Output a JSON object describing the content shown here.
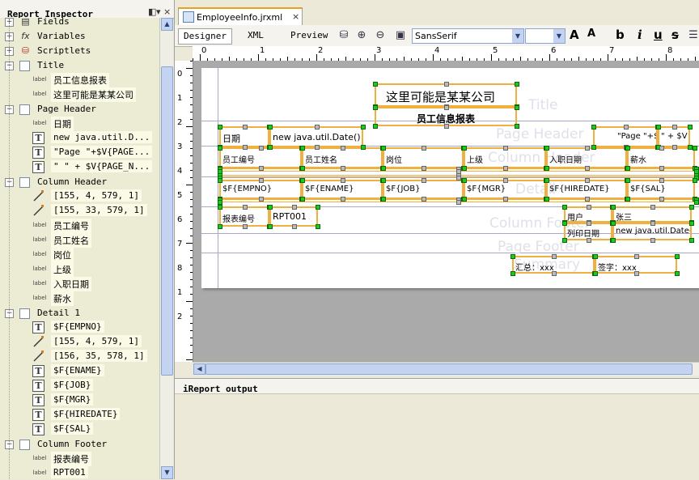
{
  "inspector": {
    "title": "Report Inspector",
    "buttons": [
      "◧",
      "▾",
      "×"
    ],
    "rows": [
      {
        "label": "Fields",
        "type": "category"
      },
      {
        "label": "Variables",
        "type": "category"
      },
      {
        "label": "Scriptlets",
        "type": "category"
      },
      {
        "label": "Title",
        "type": "band"
      },
      {
        "label": "员工信息报表",
        "type": "label"
      },
      {
        "label": "这里可能是某某公司",
        "type": "label"
      },
      {
        "label": "Page Header",
        "type": "band"
      },
      {
        "label": "日期",
        "type": "label"
      },
      {
        "label": "new java.util.D...",
        "type": "textfield"
      },
      {
        "label": "\"Page \"+$V{PAGE...",
        "type": "textfield"
      },
      {
        "label": "\" \" + $V{PAGE_N...",
        "type": "textfield"
      },
      {
        "label": "Column Header",
        "type": "band"
      },
      {
        "label": "[155, 4, 579, 1]",
        "type": "line"
      },
      {
        "label": "[155, 33, 579, 1]",
        "type": "line"
      },
      {
        "label": "员工编号",
        "type": "label"
      },
      {
        "label": "员工姓名",
        "type": "label"
      },
      {
        "label": "岗位",
        "type": "label"
      },
      {
        "label": "上级",
        "type": "label"
      },
      {
        "label": "入职日期",
        "type": "label"
      },
      {
        "label": "薪水",
        "type": "label"
      },
      {
        "label": "Detail 1",
        "type": "band"
      },
      {
        "label": "$F{EMPNO}",
        "type": "textfield"
      },
      {
        "label": "[155, 4, 579, 1]",
        "type": "line"
      },
      {
        "label": "[156, 35, 578, 1]",
        "type": "line"
      },
      {
        "label": "$F{ENAME}",
        "type": "textfield"
      },
      {
        "label": "$F{JOB}",
        "type": "textfield"
      },
      {
        "label": "$F{MGR}",
        "type": "textfield"
      },
      {
        "label": "$F{HIREDATE}",
        "type": "textfield"
      },
      {
        "label": "$F{SAL}",
        "type": "textfield"
      },
      {
        "label": "Column Footer",
        "type": "band"
      },
      {
        "label": "报表编号",
        "type": "label"
      },
      {
        "label": "RPT001",
        "type": "label"
      }
    ],
    "fx_label": "fx",
    "label_icon": "label"
  },
  "editor": {
    "tab_title": "EmployeeInfo.jrxml",
    "tab_close": "×",
    "views": [
      "Designer",
      "XML",
      "Preview"
    ],
    "font_name": "SansSerif",
    "font_size": "",
    "format_buttons": [
      "A",
      "A",
      "b",
      "i",
      "u",
      "s"
    ],
    "ruler_numbers_h": [
      "0",
      "1",
      "2",
      "3",
      "4",
      "5",
      "6",
      "7",
      "8"
    ],
    "ruler_numbers_v": [
      "0",
      "1",
      "2",
      "3",
      "4",
      "5",
      "6",
      "7",
      "8",
      "1",
      "2"
    ],
    "band_names": [
      "Title",
      "Page Header",
      "Column Header",
      "Detail",
      "Column Footer",
      "Page Footer",
      "Summary"
    ],
    "elements": {
      "company": "这里可能是某某公司",
      "report_title": "员工信息报表",
      "date_label": "日期",
      "date_field": "new java.util.Date()",
      "page_field": "\"Page \"+$V",
      "page_total": "\" + $V",
      "col_empno": "员工编号",
      "col_ename": "员工姓名",
      "col_job": "岗位",
      "col_mgr": "上级",
      "col_hiredate": "入职日期",
      "col_sal": "薪水",
      "f_empno": "$F{EMPNO}",
      "f_ename": "$F{ENAME}",
      "f_job": "$F{JOB}",
      "f_mgr": "$F{MGR}",
      "f_hiredate": "$F{HIREDATE}",
      "f_sal": "$F{SAL}",
      "report_no_label": "报表编号",
      "report_no": "RPT001",
      "user_label": "用户",
      "user_value": "张三",
      "print_date_label": "列印日期",
      "print_date": "new java.util.Date()",
      "total": "汇总：xxx",
      "sign": "签字：xxx"
    }
  },
  "output": {
    "title": "iReport output"
  }
}
